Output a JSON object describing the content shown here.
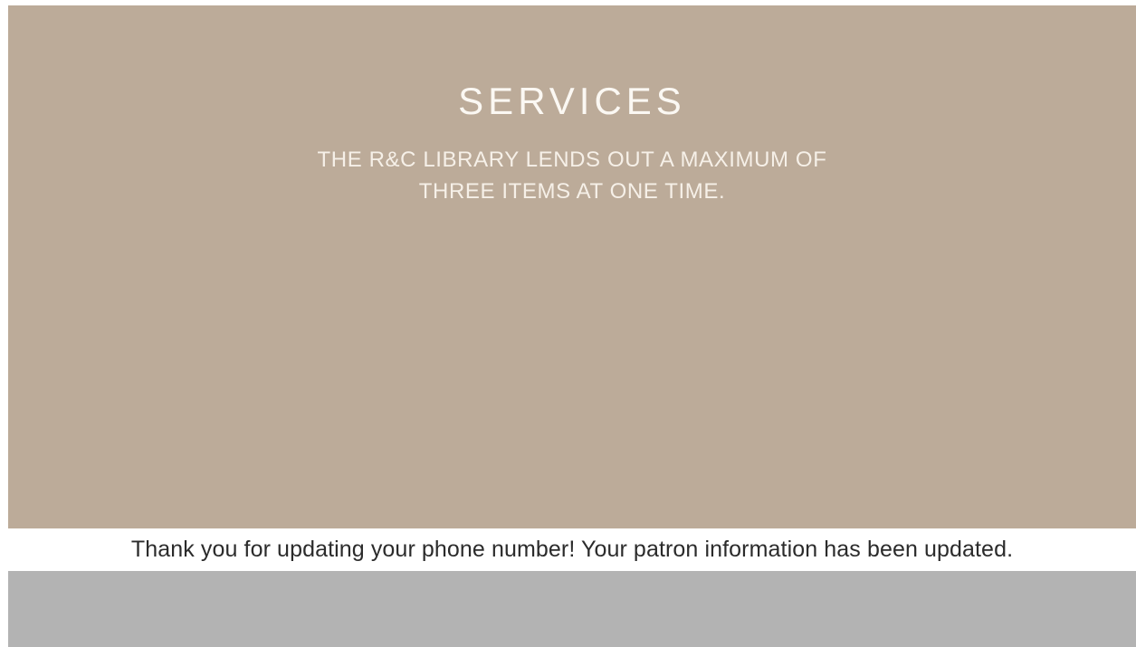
{
  "hero": {
    "title": "SERVICES",
    "line1": "THE R&C LIBRARY LENDS OUT A MAXIMUM OF",
    "line2": "THREE ITEMS AT ONE TIME."
  },
  "notice": {
    "text": "Thank you for updating your phone number! Your patron information has been updated."
  },
  "colors": {
    "hero_bg": "#bcab99",
    "footer_bg": "#b3b3b3",
    "notice_text": "#2b2b2b"
  }
}
